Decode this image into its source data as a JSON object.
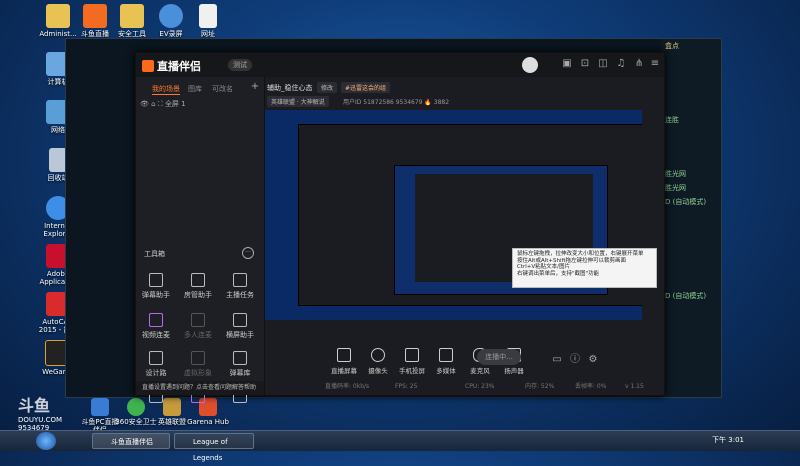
{
  "desktop_icons": [
    {
      "label": "Administ..."
    },
    {
      "label": "斗鱼直播"
    },
    {
      "label": "安全工具"
    },
    {
      "label": "EV录屏"
    },
    {
      "label": "网址"
    },
    {
      "label": "计算机"
    },
    {
      "label": "网络"
    },
    {
      "label": "回收站"
    },
    {
      "label": "Internet Explorer"
    },
    {
      "label": "Adobe Applicati..."
    },
    {
      "label": "AutoCAD 2015 - 简..."
    },
    {
      "label": "WeGame"
    }
  ],
  "bottom_desktop_icons": [
    {
      "label": "斗鱼PC直播伴侣"
    },
    {
      "label": "360安全卫士"
    },
    {
      "label": "英雄联盟"
    },
    {
      "label": "Garena Hub"
    }
  ],
  "watermark": {
    "brand": "斗鱼",
    "sub": "DOUYU.COM",
    "room_id": "9534679"
  },
  "lol_side": {
    "lines": [
      "连胜",
      "胜光网",
      "胜光网",
      "D (自动模式)",
      "D (自动模式)"
    ],
    "top_right": "盒点"
  },
  "app": {
    "name": "直播伴侣",
    "version_badge": "测试",
    "left_tabs": [
      "我的场景",
      "图库",
      "可改名"
    ],
    "scene_name": "全屏 1",
    "tools_title": "工具箱",
    "tools": [
      {
        "label": "弹幕助手",
        "dim": false
      },
      {
        "label": "房管助手",
        "dim": false
      },
      {
        "label": "主播任务",
        "dim": false
      },
      {
        "label": "视频连麦",
        "dim": false
      },
      {
        "label": "多人连麦",
        "dim": true
      },
      {
        "label": "横屏助手",
        "dim": false
      },
      {
        "label": "设计路",
        "dim": false
      },
      {
        "label": "虚拟形象",
        "dim": true
      },
      {
        "label": "弹幕库",
        "dim": false
      },
      {
        "label": "回放",
        "dim": false
      },
      {
        "label": "",
        "dim": true
      },
      {
        "label": "",
        "dim": false
      }
    ],
    "notice": "直播设置遇到问题？点击查看问题解答帮助",
    "room_title": "辅助_稳住心态",
    "edit_chip": "修改",
    "tag_chip": "#迅雷这会的组",
    "category_chip": "英雄联盟 · 大神解说",
    "room_meta": "用户ID 51872586   9534679   🔥 3882",
    "tooltip_lines": [
      "鼠标左键拖拽，拉伸改变大小和位置，右键展开菜单",
      "按住Alt或Alt+Shift拖左键拉伸可以裁剪画面",
      "Ctrl+V粘贴文本/图片",
      "右键调出菜单后，支持\"截图\"功能"
    ],
    "controls": [
      "直播屏幕",
      "摄像头",
      "手机投屏",
      "多媒体",
      "麦克风",
      "扬声器"
    ],
    "live_button": "连播中...",
    "status": [
      "直播码率: 0kb/s",
      "FPS: 25",
      "CPU: 23%",
      "内存: 52%",
      "丢帧率: 0%",
      "v 1.15"
    ]
  },
  "taskbar": {
    "tasks": [
      "斗鱼直播伴侣",
      "League of Legends"
    ],
    "clock": "下午 3:01"
  },
  "colors": {
    "accent": "#ff7a2f",
    "desktop": "#0f3d7a",
    "app_bg": "#1b1c21"
  }
}
